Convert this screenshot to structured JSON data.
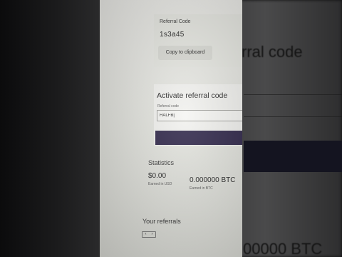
{
  "background": {
    "heading_fragment": "rral code",
    "value_fragment": "00000 BTC"
  },
  "referral": {
    "label": "Referral Code",
    "code": "1s3a45",
    "copy_label": "Copy to clipboard"
  },
  "activate": {
    "title": "Activate referral code",
    "field_label": "Referral code",
    "field_value": "HALFB|",
    "button_color": "#2b2246"
  },
  "statistics": {
    "title": "Statistics",
    "usd_value": "$0.00",
    "usd_label": "Earned in USD",
    "btc_value": "0.000000 BTC",
    "btc_label": "Earned in BTC"
  },
  "referrals": {
    "title": "Your referrals",
    "pager_prev": "‹",
    "pager_next": "›"
  }
}
